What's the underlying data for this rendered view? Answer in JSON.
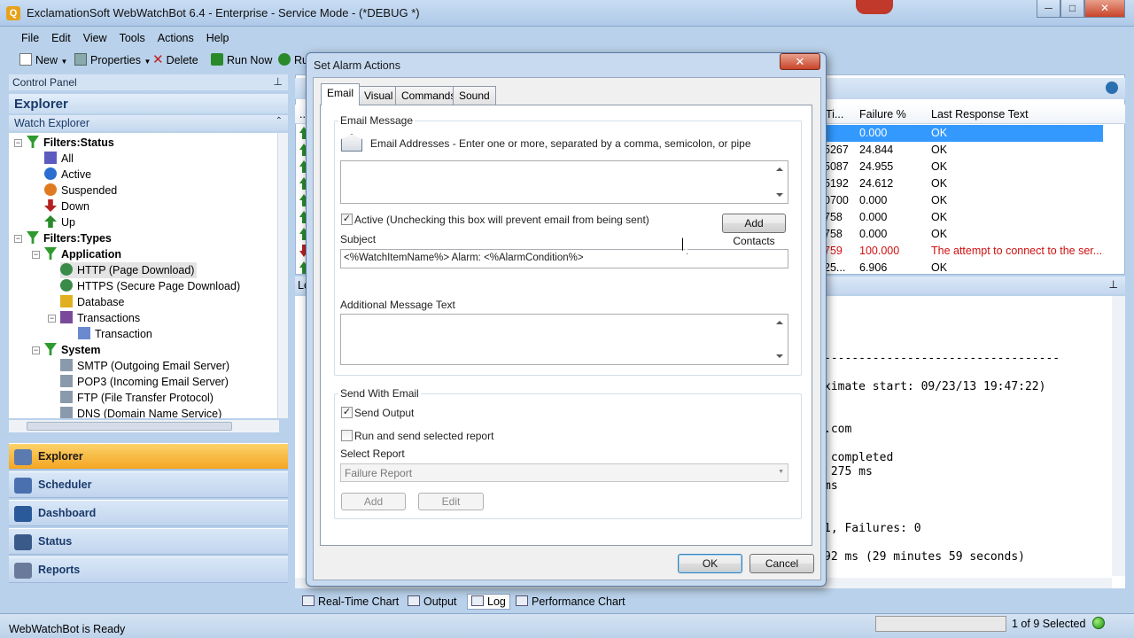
{
  "window": {
    "title": "ExclamationSoft WebWatchBot 6.4 - Enterprise - Service Mode - (*DEBUG *)",
    "app_icon": "Q"
  },
  "menu": [
    "File",
    "Edit",
    "View",
    "Tools",
    "Actions",
    "Help"
  ],
  "toolbar": {
    "new_label": "New",
    "properties_label": "Properties",
    "delete_label": "Delete",
    "run_now_label": "Run Now",
    "run_label": "Ru"
  },
  "left_panel": {
    "control_panel": "Control Panel",
    "explorer_title": "Explorer",
    "watch_explorer": "Watch Explorer",
    "tree": {
      "filters_status": "Filters:Status",
      "all": "All",
      "active": "Active",
      "suspended": "Suspended",
      "down": "Down",
      "up": "Up",
      "filters_types": "Filters:Types",
      "application": "Application",
      "http": "HTTP (Page Download)",
      "https": "HTTPS (Secure Page Download)",
      "database": "Database",
      "transactions": "Transactions",
      "transaction": "Transaction",
      "system": "System",
      "smtp": "SMTP (Outgoing Email Server)",
      "pop3": "POP3 (Incoming Email Server)",
      "ftp": "FTP (File Transfer Protocol)",
      "dns": "DNS (Domain Name Service)"
    },
    "nav": [
      "Explorer",
      "Scheduler",
      "Dashboard",
      "Status",
      "Reports"
    ]
  },
  "grid": {
    "col_time_partial": "Ti...",
    "col_failure": "Failure %",
    "col_last_response": "Last Response Text",
    "col_left_partial": "...",
    "rows": [
      {
        "time": "",
        "failure": "0.000",
        "text": "OK",
        "status": "up",
        "selected": true
      },
      {
        "time": "5267",
        "failure": "24.844",
        "text": "OK",
        "status": "up"
      },
      {
        "time": "5087",
        "failure": "24.955",
        "text": "OK",
        "status": "up"
      },
      {
        "time": "5192",
        "failure": "24.612",
        "text": "OK",
        "status": "up"
      },
      {
        "time": "0700",
        "failure": "0.000",
        "text": "OK",
        "status": "up"
      },
      {
        "time": "758",
        "failure": "0.000",
        "text": "OK",
        "status": "up"
      },
      {
        "time": "758",
        "failure": "0.000",
        "text": "OK",
        "status": "up"
      },
      {
        "time": "759",
        "failure": "100.000",
        "text": "The attempt to connect to the ser...",
        "status": "down"
      },
      {
        "time": "25...",
        "failure": "6.906",
        "text": "OK",
        "status": "up"
      }
    ]
  },
  "log": {
    "header_partial": "Lo",
    "lines": [
      "----------------------------------",
      "ximate start: 09/23/13 19:47:22)",
      ".com",
      " completed",
      " 275 ms",
      "ms",
      "1, Failures: 0",
      "92 ms (29 minutes 59 seconds)"
    ]
  },
  "bottom_tabs": [
    "Real-Time Chart",
    "Output",
    "Log",
    "Performance Chart"
  ],
  "status": {
    "text": "WebWatchBot is Ready",
    "selection": "1 of 9 Selected"
  },
  "dialog": {
    "title": "Set Alarm Actions",
    "close": "✕",
    "tabs": [
      "Email",
      "Visual",
      "Commands",
      "Sound"
    ],
    "email_message_group": "Email Message",
    "email_addresses_label": "Email Addresses - Enter one or more, separated by a comma, semicolon, or pipe",
    "email_addresses_value": "",
    "active_label": "Active (Unchecking this box will prevent email from being sent)",
    "active_checked": true,
    "add_contacts": "Add Contacts",
    "subject_label": "Subject",
    "subject_value": "<%WatchItemName%> Alarm: <%AlarmCondition%>",
    "additional_label": "Additional Message Text",
    "additional_value": "",
    "send_with_group": "Send With Email",
    "send_output_label": "Send Output",
    "send_output_checked": true,
    "run_report_label": "Run and send selected report",
    "run_report_checked": false,
    "select_report_label": "Select Report",
    "select_report_value": "Failure Report",
    "add_btn": "Add",
    "edit_btn": "Edit",
    "ok": "OK",
    "cancel": "Cancel"
  }
}
